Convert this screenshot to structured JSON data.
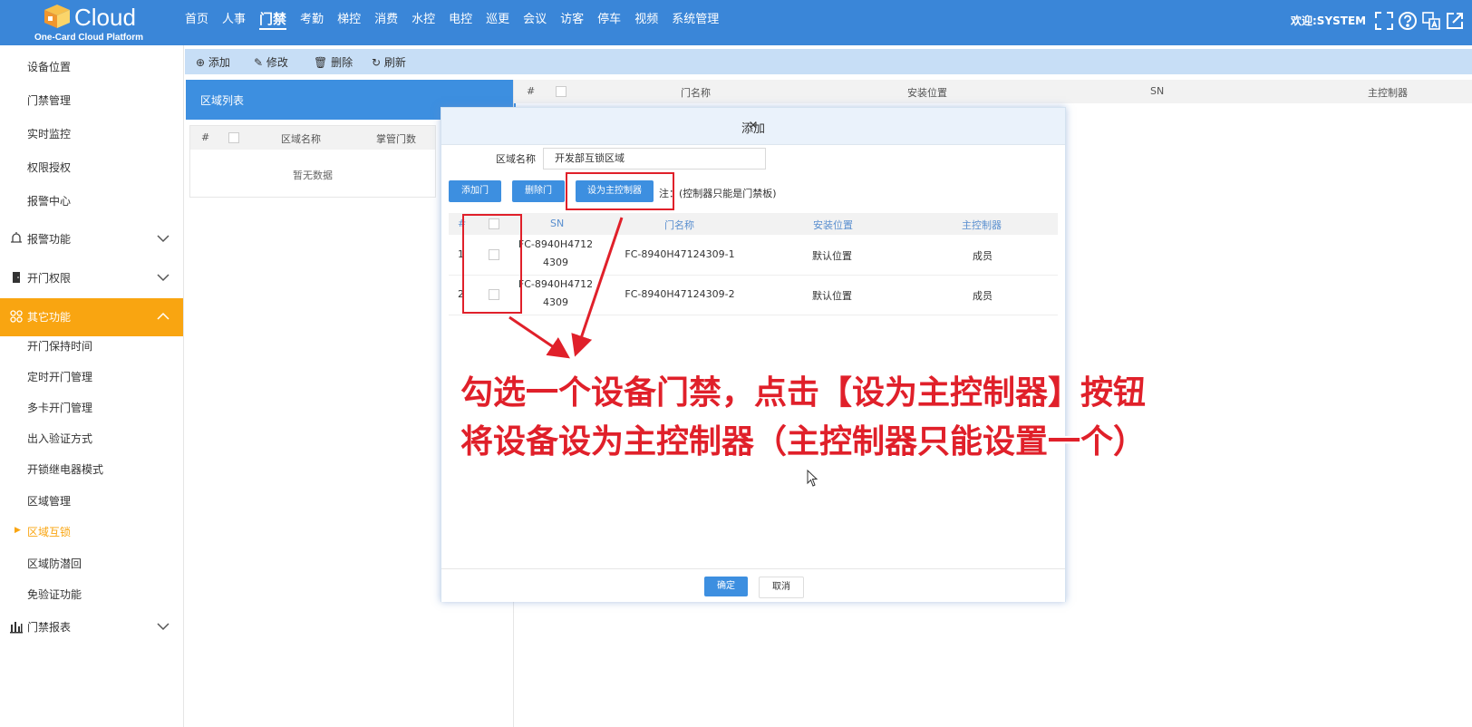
{
  "brand": {
    "name": "Cloud",
    "subtitle": "One-Card Cloud Platform"
  },
  "nav": [
    "首页",
    "人事",
    "门禁",
    "考勤",
    "梯控",
    "消费",
    "水控",
    "电控",
    "巡更",
    "会议",
    "访客",
    "停车",
    "视频",
    "系统管理"
  ],
  "nav_active": "门禁",
  "welcome": "欢迎:SYSTEM",
  "sidebar": {
    "top_items": [
      "设备位置",
      "门禁管理",
      "实时监控",
      "权限授权",
      "报警中心"
    ],
    "groups": {
      "alarm": "报警功能",
      "door_perm": "开门权限",
      "other": "其它功能",
      "report": "门禁报表"
    },
    "other_items": [
      "开门保持时间",
      "定时开门管理",
      "多卡开门管理",
      "出入验证方式",
      "开锁继电器模式",
      "区域管理",
      "区域互锁",
      "区域防潜回",
      "免验证功能"
    ],
    "selected": "区域互锁"
  },
  "toolbar": {
    "add": "添加",
    "edit": "修改",
    "delete": "删除",
    "refresh": "刷新"
  },
  "area_panel": {
    "title": "区域列表",
    "col_no": "#",
    "col_name": "区域名称",
    "col_doors": "掌管门数",
    "empty": "暂无数据"
  },
  "right_table": {
    "col_no": "#",
    "col_door": "门名称",
    "col_loc": "安装位置",
    "col_sn": "SN",
    "col_ctrl": "主控制器"
  },
  "modal": {
    "title": "添加",
    "close": "×",
    "field_label": "区域名称",
    "field_value": "开发部互锁区域",
    "btn_add_door": "添加门",
    "btn_del_door": "删除门",
    "btn_set_master": "设为主控制器",
    "note": "注：(控制器只能是门禁板)",
    "cols": {
      "no": "#",
      "sn": "SN",
      "door": "门名称",
      "loc": "安装位置",
      "ctrl": "主控制器"
    },
    "rows": [
      {
        "no": "1",
        "sn1": "FC-8940H4712",
        "sn2": "4309",
        "door": "FC-8940H47124309-1",
        "loc": "默认位置",
        "ctrl": "成员"
      },
      {
        "no": "2",
        "sn1": "FC-8940H4712",
        "sn2": "4309",
        "door": "FC-8940H47124309-2",
        "loc": "默认位置",
        "ctrl": "成员"
      }
    ],
    "btn_ok": "确定",
    "btn_cancel": "取消"
  },
  "annotation": {
    "line1": "勾选一个设备门禁，点击【设为主控制器】按钮",
    "line2": "将设备设为主控制器（主控制器只能设置一个）",
    "color": "#e0202a"
  },
  "colors": {
    "topbar": "#3a86d8",
    "accent": "#f9a511",
    "primary": "#3d8fe0"
  }
}
